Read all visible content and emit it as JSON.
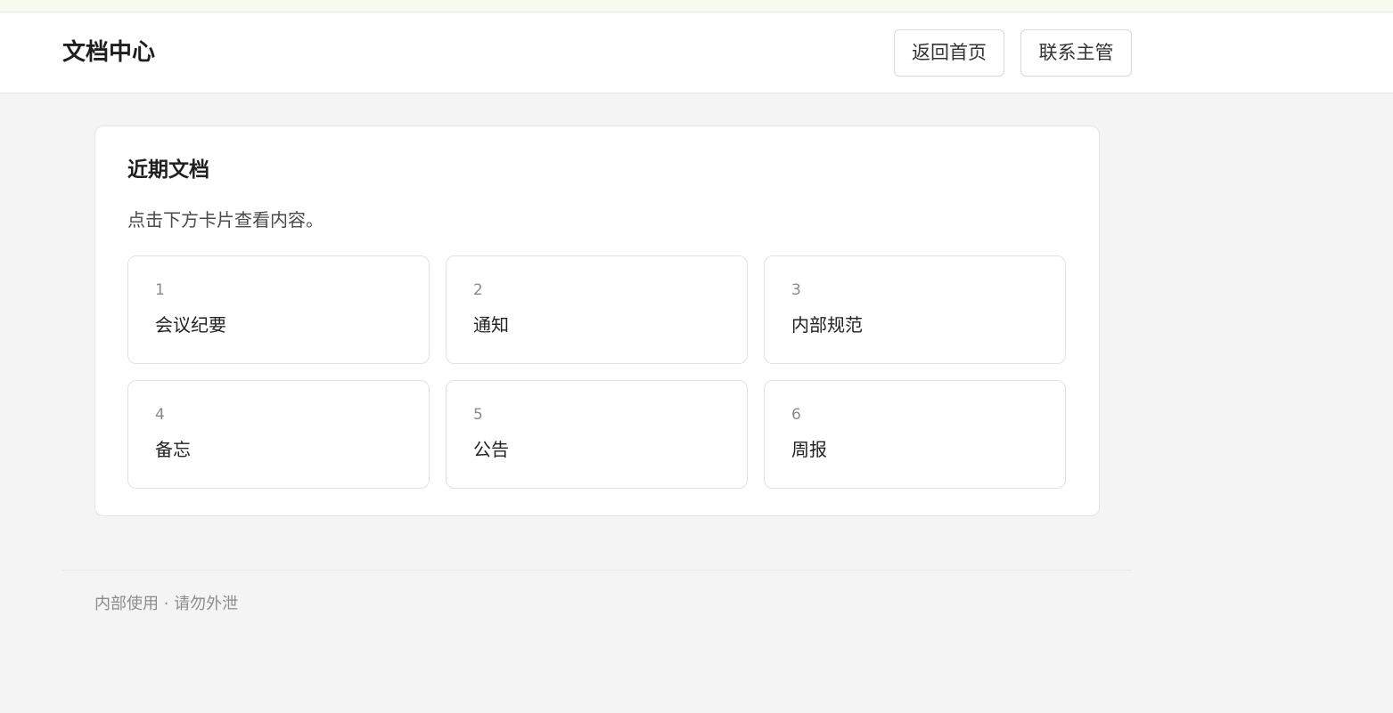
{
  "header": {
    "title": "文档中心",
    "buttons": {
      "home": "返回首页",
      "contact": "联系主管"
    }
  },
  "panel": {
    "title": "近期文档",
    "description": "点击下方卡片查看内容。",
    "cards": [
      {
        "number": "1",
        "label": "会议纪要"
      },
      {
        "number": "2",
        "label": "通知"
      },
      {
        "number": "3",
        "label": "内部规范"
      },
      {
        "number": "4",
        "label": "备忘"
      },
      {
        "number": "5",
        "label": "公告"
      },
      {
        "number": "6",
        "label": "周报"
      }
    ]
  },
  "footer": {
    "text": "内部使用 · 请勿外泄"
  },
  "colors": {
    "page_background": "#f4f4f4",
    "card_background": "#ffffff",
    "top_strip": "#f6faef",
    "border": "#e1e1e1"
  }
}
